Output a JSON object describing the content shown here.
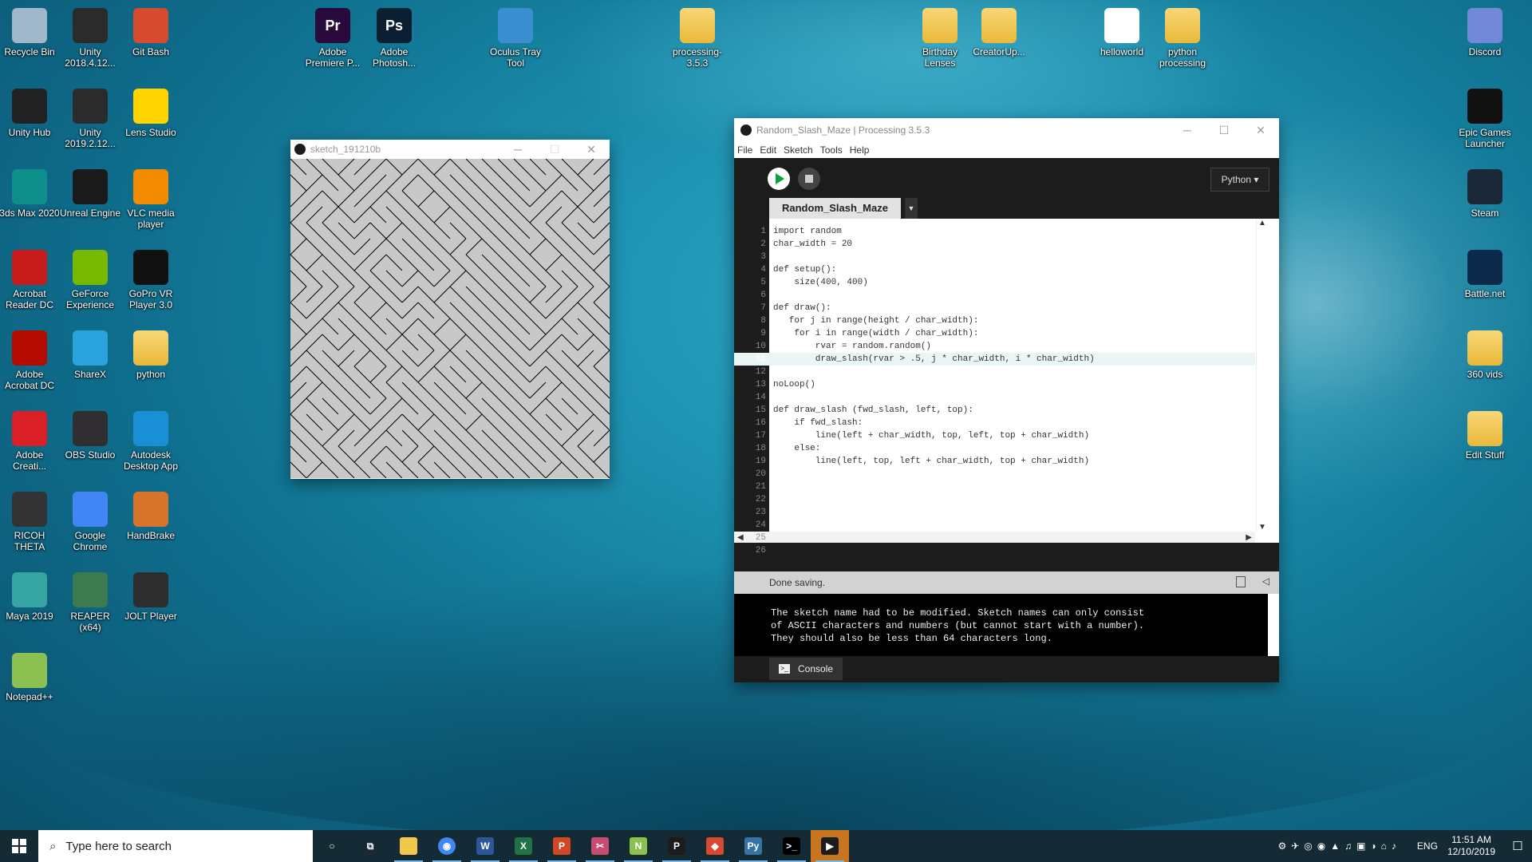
{
  "desktop": {
    "left_icons": [
      {
        "label": "Recycle Bin",
        "icon": "recycle-bin-icon",
        "color": "#9fb7c9"
      },
      {
        "label": "Unity 2018.4.12...",
        "icon": "unity-icon",
        "color": "#2b2b2b"
      },
      {
        "label": "Git Bash",
        "icon": "git-bash-icon",
        "color": "#d64b2f"
      },
      {
        "label": "Unity Hub",
        "icon": "unity-hub-icon",
        "color": "#222222"
      },
      {
        "label": "Unity 2019.2.12...",
        "icon": "unity-icon",
        "color": "#2b2b2b"
      },
      {
        "label": "Lens Studio",
        "icon": "lens-studio-icon",
        "color": "#ffd400"
      },
      {
        "label": "3ds Max 2020",
        "icon": "3ds-max-icon",
        "color": "#0e8f8b"
      },
      {
        "label": "Unreal Engine",
        "icon": "unreal-engine-icon",
        "color": "#1a1a1a"
      },
      {
        "label": "VLC media player",
        "icon": "vlc-icon",
        "color": "#f28b00"
      },
      {
        "label": "Acrobat Reader DC",
        "icon": "acrobat-reader-icon",
        "color": "#c81b1b"
      },
      {
        "label": "GeForce Experience",
        "icon": "geforce-icon",
        "color": "#76b900"
      },
      {
        "label": "GoPro VR Player 3.0",
        "icon": "gopro-icon",
        "color": "#111111"
      },
      {
        "label": "Adobe Acrobat DC",
        "icon": "acrobat-icon",
        "color": "#b30b00"
      },
      {
        "label": "ShareX",
        "icon": "sharex-icon",
        "color": "#2aa3dd"
      },
      {
        "label": "python",
        "icon": "folder-icon",
        "color": "#f1c84b"
      },
      {
        "label": "Adobe Creati...",
        "icon": "creative-cloud-icon",
        "color": "#da1f26"
      },
      {
        "label": "OBS Studio",
        "icon": "obs-icon",
        "color": "#302e31"
      },
      {
        "label": "Autodesk Desktop App",
        "icon": "autodesk-icon",
        "color": "#1b8fd6"
      },
      {
        "label": "RICOH THETA",
        "icon": "ricoh-theta-icon",
        "color": "#333333"
      },
      {
        "label": "Google Chrome",
        "icon": "chrome-icon",
        "color": "#4285f4"
      },
      {
        "label": "HandBrake",
        "icon": "handbrake-icon",
        "color": "#d9742c"
      },
      {
        "label": "Maya 2019",
        "icon": "maya-icon",
        "color": "#37a5a2"
      },
      {
        "label": "REAPER (x64)",
        "icon": "reaper-icon",
        "color": "#3d7a4f"
      },
      {
        "label": "JOLT Player",
        "icon": "jolt-player-icon",
        "color": "#2d2d2d"
      },
      {
        "label": "Notepad++",
        "icon": "notepad-plus-icon",
        "color": "#8cc152"
      }
    ],
    "top_icons": [
      {
        "label": "Adobe Premiere P...",
        "icon": "premiere-icon",
        "color": "#2a0a3c",
        "text": "Pr"
      },
      {
        "label": "Adobe Photosh...",
        "icon": "photoshop-icon",
        "color": "#0b1f33",
        "text": "Ps"
      },
      {
        "label": "Oculus Tray Tool",
        "icon": "oculus-tray-icon",
        "color": "#3b8fd1",
        "text": ""
      },
      {
        "label": "processing-3.5.3",
        "icon": "folder-icon",
        "color": "#f1c84b",
        "text": ""
      },
      {
        "label": "Birthday Lenses",
        "icon": "folder-icon",
        "color": "#f1c84b",
        "text": ""
      },
      {
        "label": "CreatorUp...",
        "icon": "folder-icon",
        "color": "#f1c84b",
        "text": ""
      },
      {
        "label": "helloworld",
        "icon": "python-file-icon",
        "color": "#ffffff",
        "text": ""
      },
      {
        "label": "python processing",
        "icon": "folder-icon",
        "color": "#f1c84b",
        "text": ""
      }
    ],
    "right_icons": [
      {
        "label": "Discord",
        "icon": "discord-icon",
        "color": "#7289da"
      },
      {
        "label": "Epic Games Launcher",
        "icon": "epic-games-icon",
        "color": "#111111"
      },
      {
        "label": "Steam",
        "icon": "steam-icon",
        "color": "#1b2838"
      },
      {
        "label": "Battle.net",
        "icon": "battle-net-icon",
        "color": "#0e2a4a"
      },
      {
        "label": "360 vids",
        "icon": "folder-icon",
        "color": "#f1c84b"
      },
      {
        "label": "Edit Stuff",
        "icon": "folder-icon",
        "color": "#f1c84b"
      }
    ]
  },
  "sketch_window": {
    "title": "sketch_191210b",
    "maze": "\\\\//\\/\\\\/\\\\/////\\\\\\\\\\///\\\\/\\////\\\\/\\\\\\\\/\\\\\\/\\\\\\\\//\\\\\\\\\\\\\\/\\\\/\\/\\\\\\\\\\/\\\\//\\\\\\//\\\\///////\\/\\\\\\/\\\\\\\\//\\///\\\\//\\\\/\\\\\\/\\////\\\\/\\\\/\\\\\\\\\\\\/\\/\\//\\\\\\//\\\\\\\\\\////\\\\\\\\\\\\\\/\\\\\\/\\\\\\\\\\\\\\\\\\//\\\\/\\/\\/\\\\/\\\\\\//\\/\\/\\\\\\\\\\\\\\\\\\\\\\\\/\\/\\\\\\/\\\\\\\\\\\\\\\\\\\\\\\\\\/\\\\\\\\\\\\\\\\/\\/\\\\\\\\\\\\\\\\\\\\\\\\\\\\\\\\\\\\\\\\\\\\\\\\\\\\\\\\\\\\\\\\\\\\\\\\\\\\\\\\\\\\\\\\\\\\\\\\\\\\\\\\\\\\\\\\\\\\\\\\\\\\\\"
  },
  "processing_window": {
    "title": "Random_Slash_Maze | Processing 3.5.3",
    "menu": [
      "File",
      "Edit",
      "Sketch",
      "Tools",
      "Help"
    ],
    "mode": "Python ▾",
    "tab": "Random_Slash_Maze",
    "code_lines": [
      "import random",
      "char_width = 20",
      "",
      "def setup():",
      "    size(400, 400)",
      "",
      "def draw():",
      "   for j in range(height / char_width):",
      "    for i in range(width / char_width):",
      "        rvar = random.random()",
      "        draw_slash(rvar > .5, j * char_width, i * char_width)",
      "",
      "noLoop()",
      "",
      "def draw_slash (fwd_slash, left, top):",
      "    if fwd_slash:",
      "        line(left + char_width, top, left, top + char_width)",
      "    else:",
      "        line(left, top, left + char_width, top + char_width)",
      "",
      "",
      "",
      "",
      "",
      "",
      ""
    ],
    "status": "Done saving.",
    "console_lines": [
      "The sketch name had to be modified. Sketch names can only consist",
      "of ASCII characters and numbers (but cannot start with a number).",
      "They should also be less than 64 characters long."
    ],
    "console_tab": "Console"
  },
  "taskbar": {
    "search_placeholder": "Type here to search",
    "apps": [
      {
        "name": "cortana-icon",
        "color": "#142a35",
        "glyph": "○"
      },
      {
        "name": "task-view-icon",
        "color": "#142a35",
        "glyph": "⧉"
      },
      {
        "name": "file-explorer-icon",
        "color": "#f1c84b",
        "glyph": ""
      },
      {
        "name": "chrome-icon",
        "color": "#4285f4",
        "glyph": "◉"
      },
      {
        "name": "word-icon",
        "color": "#2b579a",
        "glyph": "W"
      },
      {
        "name": "excel-icon",
        "color": "#217346",
        "glyph": "X"
      },
      {
        "name": "powerpoint-icon",
        "color": "#d24726",
        "glyph": "P"
      },
      {
        "name": "snip-icon",
        "color": "#c74b73",
        "glyph": "✂"
      },
      {
        "name": "notepad-plus-icon",
        "color": "#8cc152",
        "glyph": "N"
      },
      {
        "name": "processing-icon",
        "color": "#1c1c1c",
        "glyph": "P"
      },
      {
        "name": "git-icon",
        "color": "#d64b2f",
        "glyph": "◆"
      },
      {
        "name": "python-icon",
        "color": "#3572a5",
        "glyph": "Py"
      },
      {
        "name": "terminal-icon",
        "color": "#000000",
        "glyph": ">_"
      },
      {
        "name": "sketch-run-icon",
        "color": "#1c1c1c",
        "glyph": "▶"
      }
    ],
    "lang": "ENG",
    "time": "11:51 AM",
    "date": "12/10/2019"
  }
}
